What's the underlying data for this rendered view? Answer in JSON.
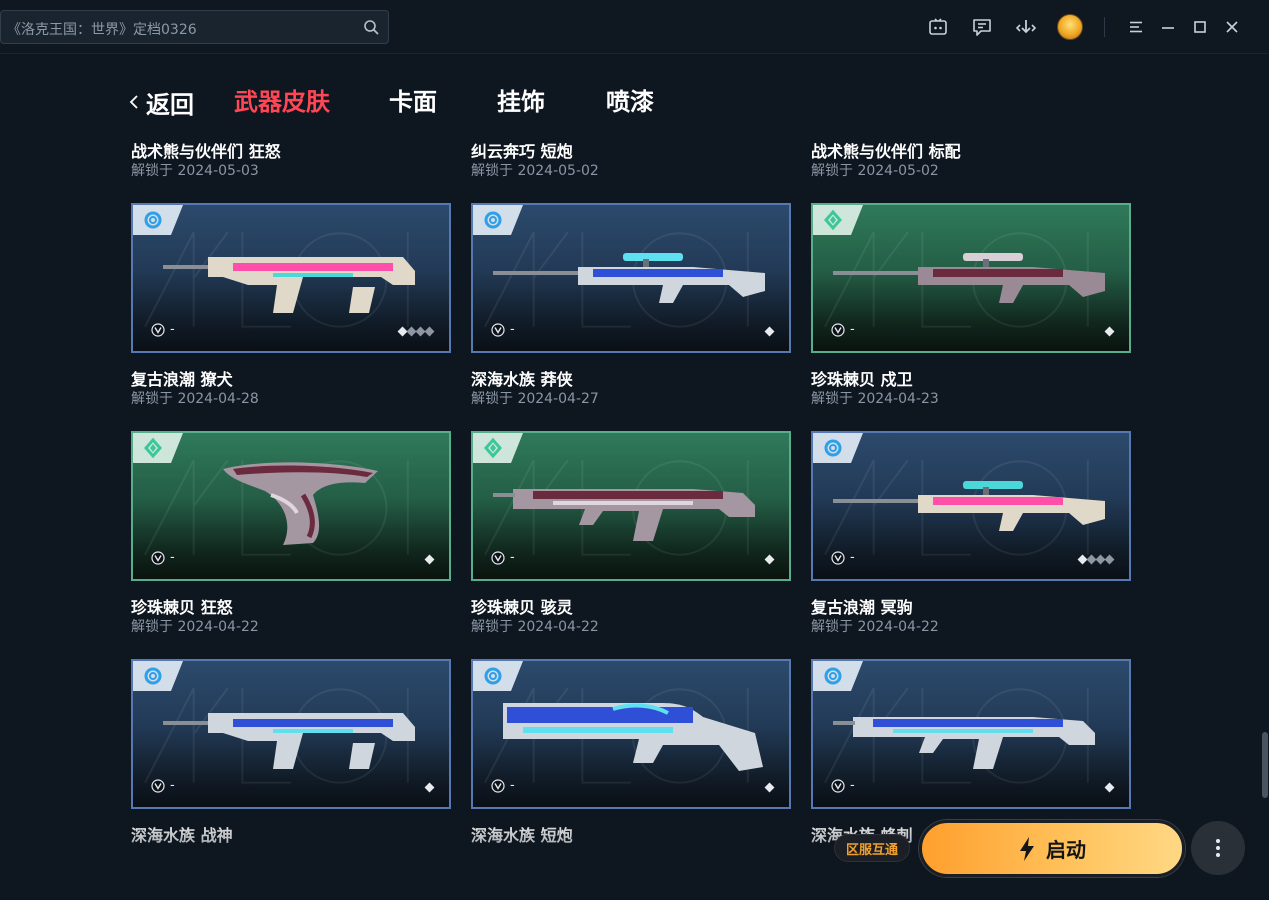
{
  "titlebar": {
    "search_text": "《洛克王国：世界》定档0326",
    "icons": [
      "search-icon",
      "game-controller-icon",
      "message-icon",
      "download-icon",
      "avatar",
      "menu-icon",
      "minimize-icon",
      "maximize-icon",
      "close-icon"
    ]
  },
  "nav": {
    "back_label": "返回",
    "tabs": [
      {
        "label": "武器皮肤",
        "active": true
      },
      {
        "label": "卡面",
        "active": false
      },
      {
        "label": "挂饰",
        "active": false
      },
      {
        "label": "喷漆",
        "active": false
      }
    ]
  },
  "top_row": [
    {
      "title": "战术熊与伙伴们 狂怒",
      "date": "解锁于 2024-05-03"
    },
    {
      "title": "纠云奔巧 短炮",
      "date": "解锁于 2024-05-02"
    },
    {
      "title": "战术熊与伙伴们 标配",
      "date": "解锁于 2024-05-02"
    }
  ],
  "cards": [
    {
      "theme": "blue",
      "weapon_style": "rifle-retro",
      "tier_text": "-",
      "diamonds": 4,
      "filled": 1,
      "title": "复古浪潮 獠犬",
      "date": "解锁于 2024-04-28"
    },
    {
      "theme": "blue",
      "weapon_style": "sniper-ocean",
      "tier_text": "-",
      "diamonds": 1,
      "filled": 1,
      "title": "深海水族 莽侠",
      "date": "解锁于 2024-04-27"
    },
    {
      "theme": "green",
      "weapon_style": "sniper-pearl",
      "tier_text": "-",
      "diamonds": 1,
      "filled": 1,
      "title": "珍珠棘贝 戍卫",
      "date": "解锁于 2024-04-23"
    },
    {
      "theme": "green",
      "weapon_style": "pistol-pearl",
      "tier_text": "-",
      "diamonds": 1,
      "filled": 1,
      "title": "珍珠棘贝 狂怒",
      "date": "解锁于 2024-04-22"
    },
    {
      "theme": "green",
      "weapon_style": "smg-pearl",
      "tier_text": "-",
      "diamonds": 1,
      "filled": 1,
      "title": "珍珠棘贝 骇灵",
      "date": "解锁于 2024-04-22"
    },
    {
      "theme": "blue",
      "weapon_style": "sniper-retro",
      "tier_text": "-",
      "diamonds": 4,
      "filled": 1,
      "title": "复古浪潮 冥驹",
      "date": "解锁于 2024-04-22"
    },
    {
      "theme": "blue",
      "weapon_style": "rifle-ocean",
      "tier_text": "-",
      "diamonds": 1,
      "filled": 1,
      "title": "深海水族 战神",
      "date": ""
    },
    {
      "theme": "blue",
      "weapon_style": "shotgun-ocean",
      "tier_text": "-",
      "diamonds": 1,
      "filled": 1,
      "title": "深海水族 短炮",
      "date": ""
    },
    {
      "theme": "blue",
      "weapon_style": "smg-ocean",
      "tier_text": "-",
      "diamonds": 1,
      "filled": 1,
      "title": "深海水族 蜂刺",
      "date": ""
    }
  ],
  "launch": {
    "server_badge": "区服互通",
    "button_label": "启动",
    "icon": "lightning-icon",
    "more_icon": "more-vertical-icon"
  },
  "colors": {
    "accent_active_tab": "#ff4655",
    "launch_gradient_start": "#ff9f2e",
    "launch_gradient_end": "#ffd884",
    "card_blue_border": "#5679b4",
    "card_green_border": "#58ad8a"
  }
}
